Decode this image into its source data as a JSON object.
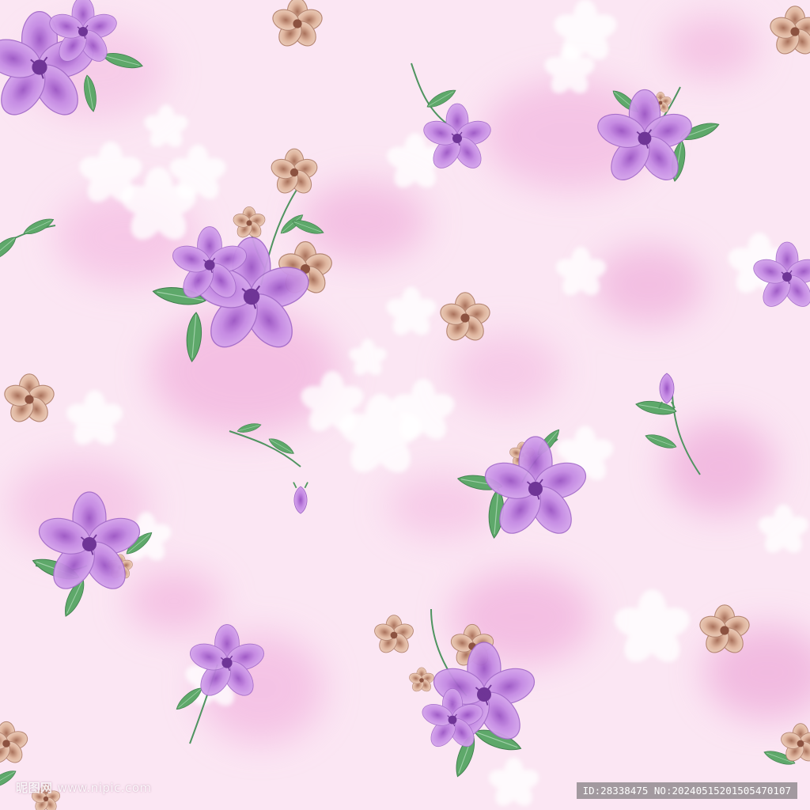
{
  "image": {
    "description_colors": {
      "background": "#fbe6f3",
      "wash": "#f0a6d9",
      "violet_petal": "#c486e0",
      "violet_dark": "#8e4bb8",
      "peach_petal": "#e2bca6",
      "peach_dark": "#a06b55",
      "leaf": "#5aa267",
      "white_flower": "#ffffff"
    }
  },
  "watermark": {
    "logo_text": "昵图网",
    "site": "www.nipic.com",
    "id_text": "ID:28338475 NO:20240515201505470107"
  }
}
